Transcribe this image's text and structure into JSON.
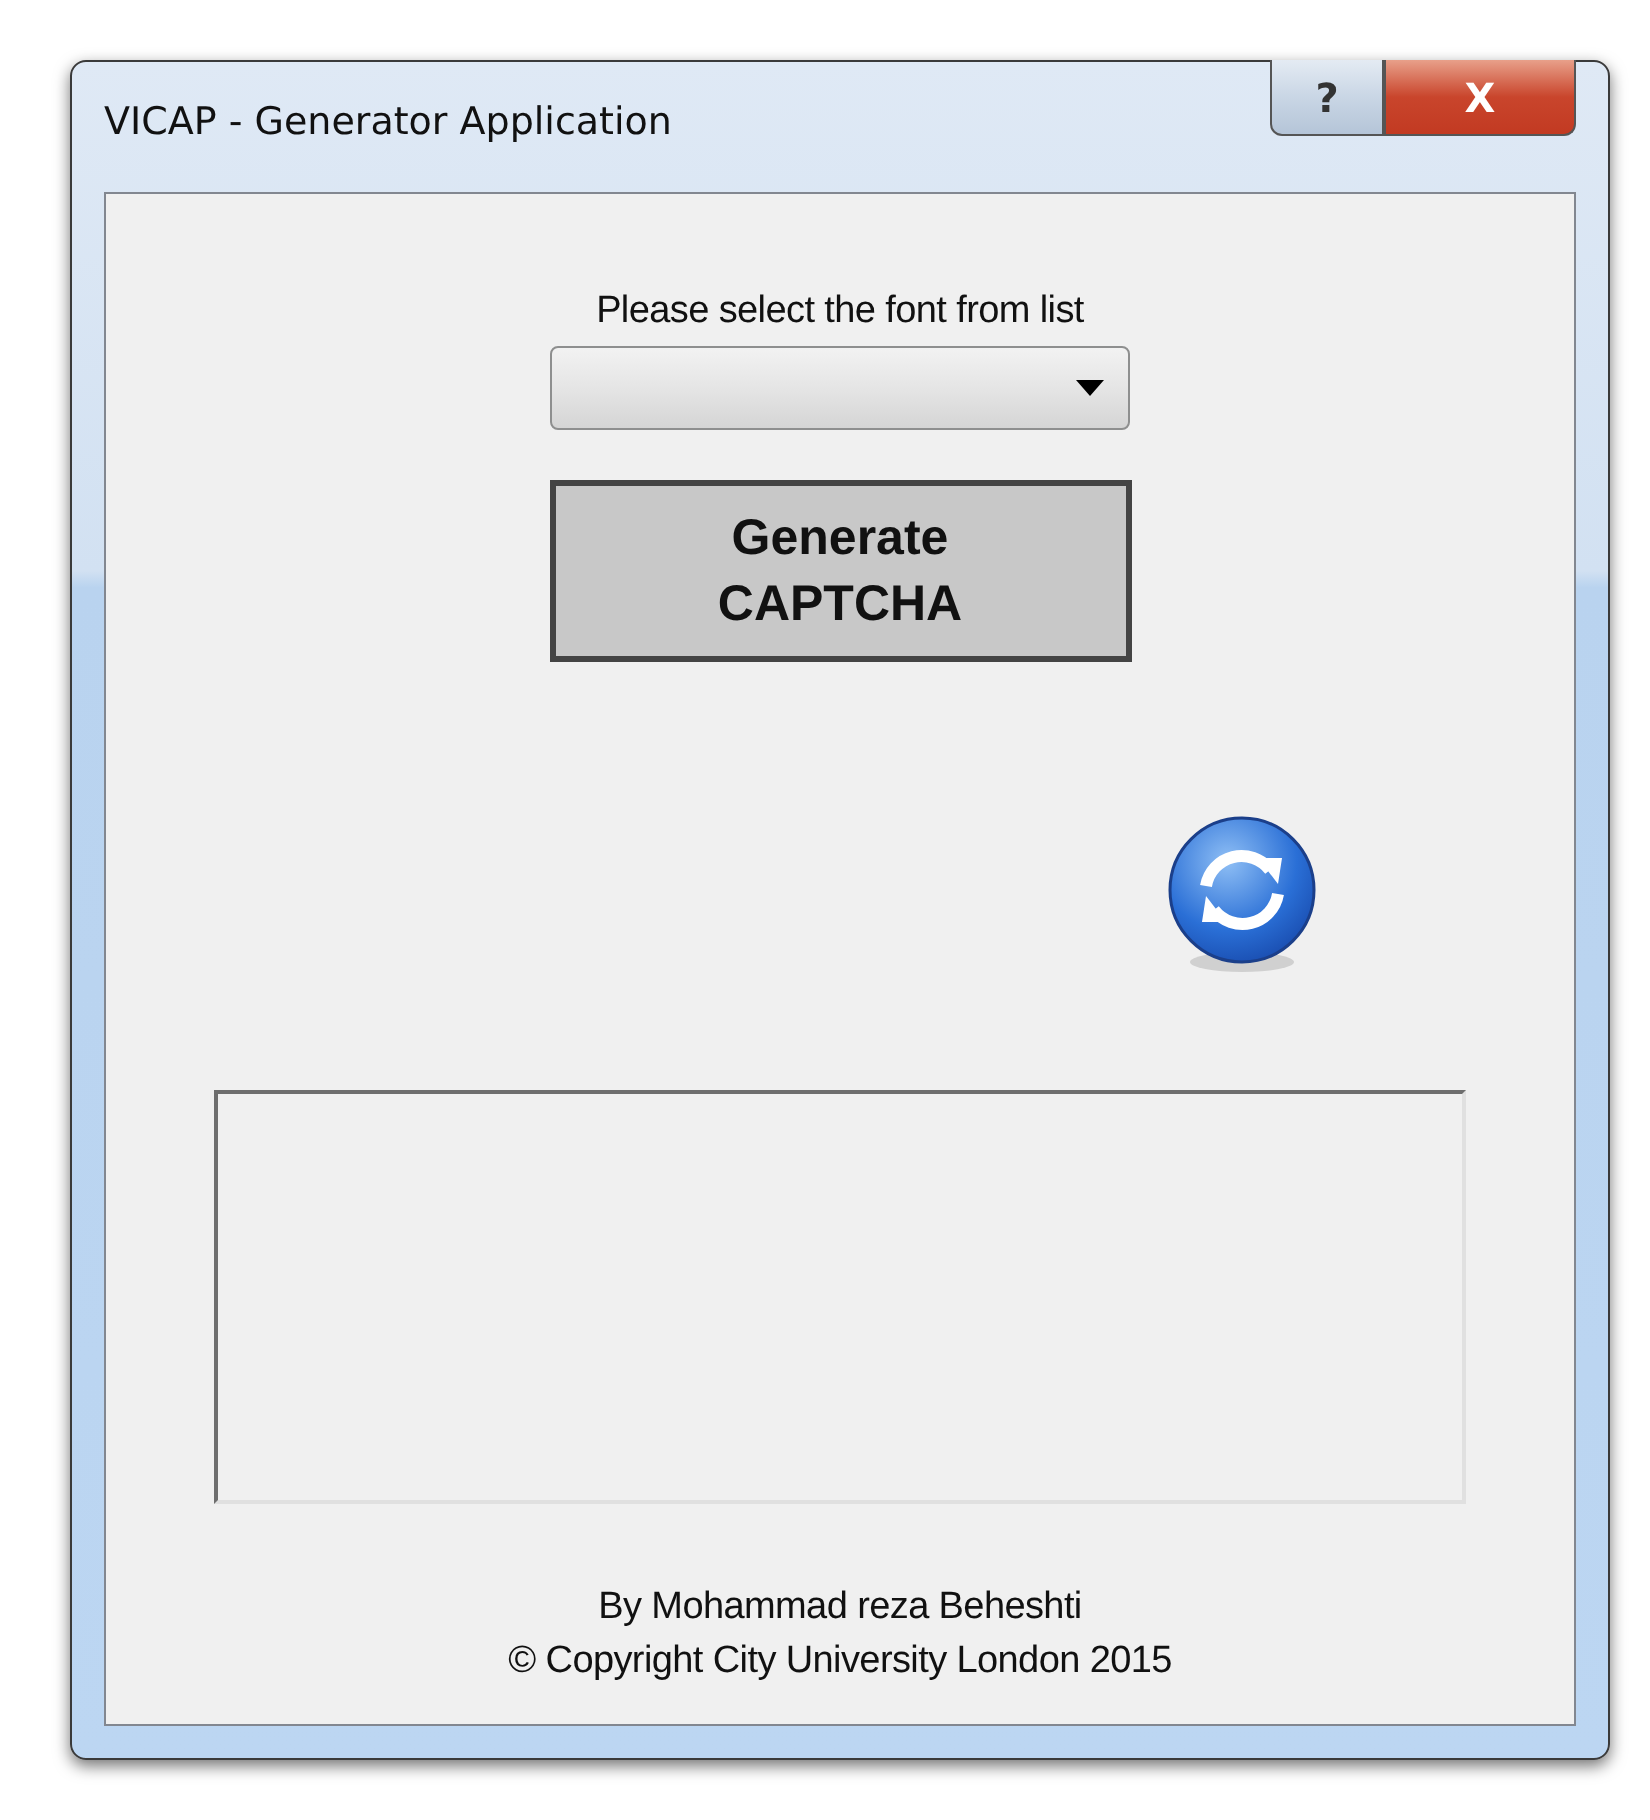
{
  "window": {
    "title": "VICAP - Generator Application",
    "buttons": [
      "?",
      "X"
    ]
  },
  "font_select": {
    "label": "Please select the font from list"
  },
  "generate_button": {
    "label": "Generate\nCAPTCHA"
  },
  "footer": [
    "By Mohammad reza Beheshti",
    "© Copyright City University London 2015"
  ]
}
